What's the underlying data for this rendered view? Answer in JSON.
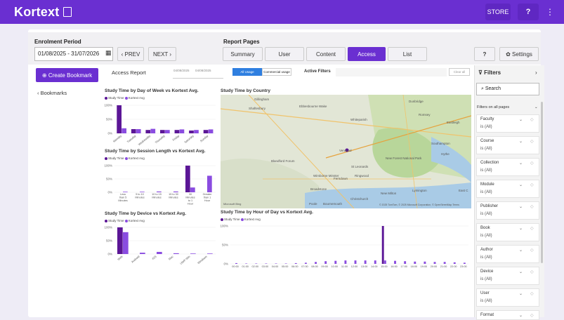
{
  "header": {
    "brand": "Kortext",
    "store": "STORE",
    "help": "?",
    "more": "⋮"
  },
  "controls": {
    "enrolment_label": "Enrolment Period",
    "date_range": "01/08/2025 - 31/07/2026",
    "prev": "‹ PREV",
    "next": "NEXT ›",
    "report_pages_label": "Report Pages",
    "tabs": [
      "Summary",
      "User",
      "Content",
      "Access",
      "List"
    ],
    "help": "?",
    "settings": "Settings"
  },
  "sidebar": {
    "create_bookmark": "Create Bookmark",
    "bookmarks": "‹ Bookmarks"
  },
  "report": {
    "title": "Access Report",
    "slider_dates": [
      "04/08/2025",
      "04/08/2025"
    ],
    "toggle_all": "All Usage",
    "toggle_commercial": "Commercial usage",
    "active_filters": "Active Filters",
    "clear_all": "Clear all"
  },
  "legend": {
    "study_time": "Study Time",
    "kortext_avg": "Kortext Avg"
  },
  "colors": {
    "study_time": "#5b1696",
    "kortext_avg": "#8a4ce0",
    "accent": "#6a2fd1"
  },
  "chart_data": [
    {
      "type": "bar",
      "title": "Study Time by Day of Week vs Kortext Avg.",
      "categories": [
        "Monday",
        "Tuesday",
        "Wednesday",
        "Thursday",
        "Friday",
        "Saturday",
        "Sunday"
      ],
      "series": [
        {
          "name": "Study Time",
          "values": [
            100,
            15,
            12,
            12,
            12,
            10,
            12
          ]
        },
        {
          "name": "Kortext Avg",
          "values": [
            18,
            15,
            16,
            12,
            14,
            12,
            14
          ]
        }
      ],
      "yticks": [
        "100%",
        "50%",
        "0%"
      ],
      "ylim": [
        0,
        100
      ]
    },
    {
      "type": "bar",
      "title": "Study Time by Session Length vs Kortext Avg.",
      "categories": [
        "Less than 5 Minutes",
        "5 to 10 Minutes",
        "10 to 15 Minutes",
        "15 to 30 Minutes",
        "30 Minutes to 1 Hour",
        "Greater than 1 Hour"
      ],
      "series": [
        {
          "name": "Study Time",
          "values": [
            0,
            0,
            0,
            0,
            100,
            0
          ]
        },
        {
          "name": "Kortext Avg",
          "values": [
            2,
            2,
            3,
            3,
            18,
            62
          ]
        }
      ],
      "yticks": [
        "100%",
        "50%",
        "0%"
      ],
      "ylim": [
        0,
        100
      ]
    },
    {
      "type": "bar",
      "title": "Study Time by Device vs Kortext Avg.",
      "categories": [
        "Web",
        "Android",
        "iOS",
        "Mac",
        "UWP Win",
        "Windows"
      ],
      "series": [
        {
          "name": "Study Time",
          "values": [
            100,
            0,
            0,
            0,
            0,
            0
          ]
        },
        {
          "name": "Kortext Avg",
          "values": [
            82,
            5,
            8,
            3,
            2,
            2
          ]
        }
      ],
      "yticks": [
        "100%",
        "50%",
        "0%"
      ],
      "ylim": [
        0,
        100
      ]
    },
    {
      "type": "bar",
      "title": "Study Time by Hour of Day vs Kortext Avg.",
      "categories": [
        "00:00",
        "01:00",
        "02:00",
        "03:00",
        "04:00",
        "05:00",
        "06:00",
        "07:00",
        "08:00",
        "09:00",
        "10:00",
        "11:00",
        "12:00",
        "13:00",
        "14:00",
        "15:00",
        "16:00",
        "17:00",
        "18:00",
        "19:00",
        "20:00",
        "21:00",
        "22:00",
        "23:00"
      ],
      "series": [
        {
          "name": "Study Time",
          "values": [
            0,
            0,
            0,
            0,
            0,
            0,
            0,
            0,
            0,
            0,
            0,
            0,
            0,
            0,
            0,
            100,
            0,
            0,
            0,
            0,
            0,
            0,
            0,
            0
          ]
        },
        {
          "name": "Kortext Avg",
          "values": [
            2,
            1,
            1,
            1,
            1,
            1,
            2,
            3,
            5,
            7,
            8,
            9,
            9,
            9,
            9,
            9,
            8,
            7,
            6,
            6,
            5,
            5,
            4,
            3
          ]
        }
      ],
      "yticks": [
        "100%",
        "50%",
        "0%"
      ],
      "ylim": [
        0,
        100
      ]
    }
  ],
  "map": {
    "title": "Study Time by Country",
    "places": [
      "Gillingham",
      "Shaftesbury",
      "Ebbesbourne Wake",
      "Dunbridge",
      "Romsey",
      "Eastleigh",
      "Whiteparish",
      "Southampton",
      "Verwood",
      "St Leonards",
      "Ringwood",
      "Blandford Forum",
      "New Forest National Park",
      "Hythe",
      "Lymington",
      "Wimborne Minster",
      "Ferndown",
      "Broadstone",
      "Christchurch",
      "New Milton",
      "Poole",
      "Bournemouth",
      "East C"
    ],
    "attribution": "© 2025 TomTom, © 2025 Microsoft Corporation, © OpenStreetMap  Terms",
    "logo": "Microsoft Bing"
  },
  "filters": {
    "title": "Filters",
    "search_placeholder": "Search",
    "section": "Filters on all pages",
    "items": [
      {
        "name": "Faculty",
        "value": "is (All)"
      },
      {
        "name": "Course",
        "value": "is (All)"
      },
      {
        "name": "Collection",
        "value": "is (All)"
      },
      {
        "name": "Module",
        "value": "is (All)"
      },
      {
        "name": "Publisher",
        "value": "is (All)"
      },
      {
        "name": "Book",
        "value": "is (All)"
      },
      {
        "name": "Author",
        "value": "is (All)"
      },
      {
        "name": "Device",
        "value": "is (All)"
      },
      {
        "name": "User",
        "value": "is (All)"
      },
      {
        "name": "Format",
        "value": ""
      }
    ]
  }
}
